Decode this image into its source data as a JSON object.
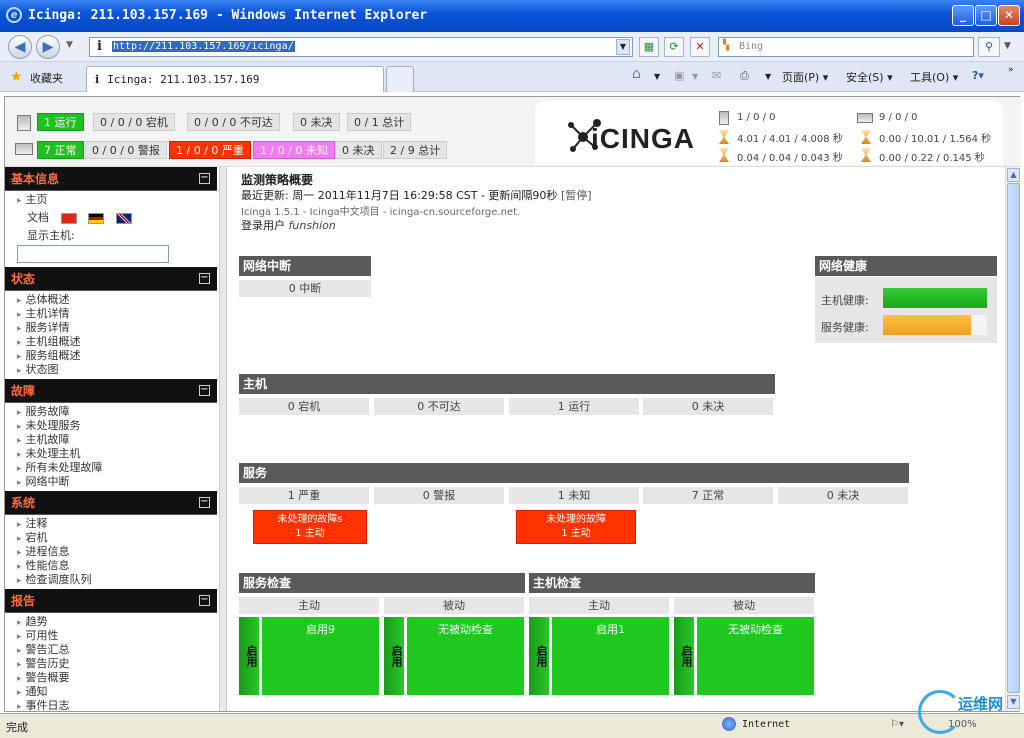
{
  "window": {
    "title": "Icinga: 211.103.157.169 - Windows Internet Explorer"
  },
  "browser": {
    "url": "http://211.103.157.169/icinga/",
    "search_placeholder": "Bing",
    "favorites_label": "收藏夹",
    "tab_title": "Icinga: 211.103.157.169",
    "cmd_page": "页面(P)",
    "cmd_safety": "安全(S)",
    "cmd_tools": "工具(O)",
    "status_text": "完成",
    "zone": "Internet",
    "zoom": "100%"
  },
  "header": {
    "host_row": [
      "1 运行",
      "0 / 0 / 0 宕机",
      "0 / 0 / 0 不可达",
      "0 未决",
      "0 / 1 总计"
    ],
    "service_row": [
      "7 正常",
      "0 / 0 / 0 警报",
      "1 / 0 / 0 严重",
      "1 / 0 / 0 未知",
      "0 未决",
      "2 / 9 总计"
    ],
    "logo": "iCINGA",
    "perf_left": [
      "1 / 0 / 0",
      "4.01 / 4.01 / 4.008 秒",
      "0.04 / 0.04 / 0.043 秒"
    ],
    "perf_right": [
      "9 / 0 / 0",
      "0.00 / 10.01 / 1.564 秒",
      "0.00 / 0.22 / 0.145 秒"
    ]
  },
  "sidebar": {
    "sections": [
      {
        "title": "基本信息",
        "items": [
          "主页"
        ]
      },
      {
        "title": "状态",
        "items": [
          "总体概述",
          "主机详情",
          "服务详情",
          "主机组概述",
          "服务组概述",
          "状态图"
        ]
      },
      {
        "title": "故障",
        "items": [
          "服务故障",
          "未处理服务",
          "主机故障",
          "未处理主机",
          "所有未处理故障",
          "网络中断"
        ]
      },
      {
        "title": "系统",
        "items": [
          "注释",
          "宕机",
          "进程信息",
          "性能信息",
          "检查调度队列"
        ]
      },
      {
        "title": "报告",
        "items": [
          "趋势",
          "可用性",
          "警告汇总",
          "警告历史",
          "警告概要",
          "通知",
          "事件日志"
        ]
      }
    ],
    "docs_label": "文档",
    "show_host_label": "显示主机:"
  },
  "main": {
    "title": "监测策略概要",
    "last_update": "最近更新: 周一  2011年11月7日  16:29:58 CST - 更新间隔90秒",
    "pause": "[暂停]",
    "version_line": "Icinga 1.5.1 - Icinga中文项目  - icinga-cn.sourceforge.net.",
    "logged_in_label": "登录用户",
    "user": "funshion",
    "outage": {
      "title": "网络中断",
      "cell": "0 中断"
    },
    "health": {
      "title": "网络健康",
      "host_label": "主机健康:",
      "service_label": "服务健康:",
      "host_level": 1.0,
      "service_level": 0.85,
      "host_color": "#33cc33",
      "service_color": "#ffc040"
    },
    "hosts": {
      "title": "主机",
      "cells": [
        "0 宕机",
        "0 不可达",
        "1 运行",
        "0 未决"
      ]
    },
    "services": {
      "title": "服务",
      "cells": [
        "1 严重",
        "0 警报",
        "1 未知",
        "7 正常",
        "0 未决"
      ],
      "alert1": {
        "line1": "未处理的故障s",
        "line2": "1 主动"
      },
      "alert2": {
        "line1": "未处理的故障",
        "line2": "1 主动"
      }
    },
    "service_checks": {
      "title": "服务检查",
      "active": "主动",
      "passive": "被动",
      "side": "启用",
      "active_val": "启用9",
      "passive_val": "无被动检查"
    },
    "host_checks": {
      "title": "主机检查",
      "active": "主动",
      "passive": "被动",
      "side": "启用",
      "active_val": "启用1",
      "passive_val": "无被动检查"
    }
  },
  "watermark": "运维网"
}
